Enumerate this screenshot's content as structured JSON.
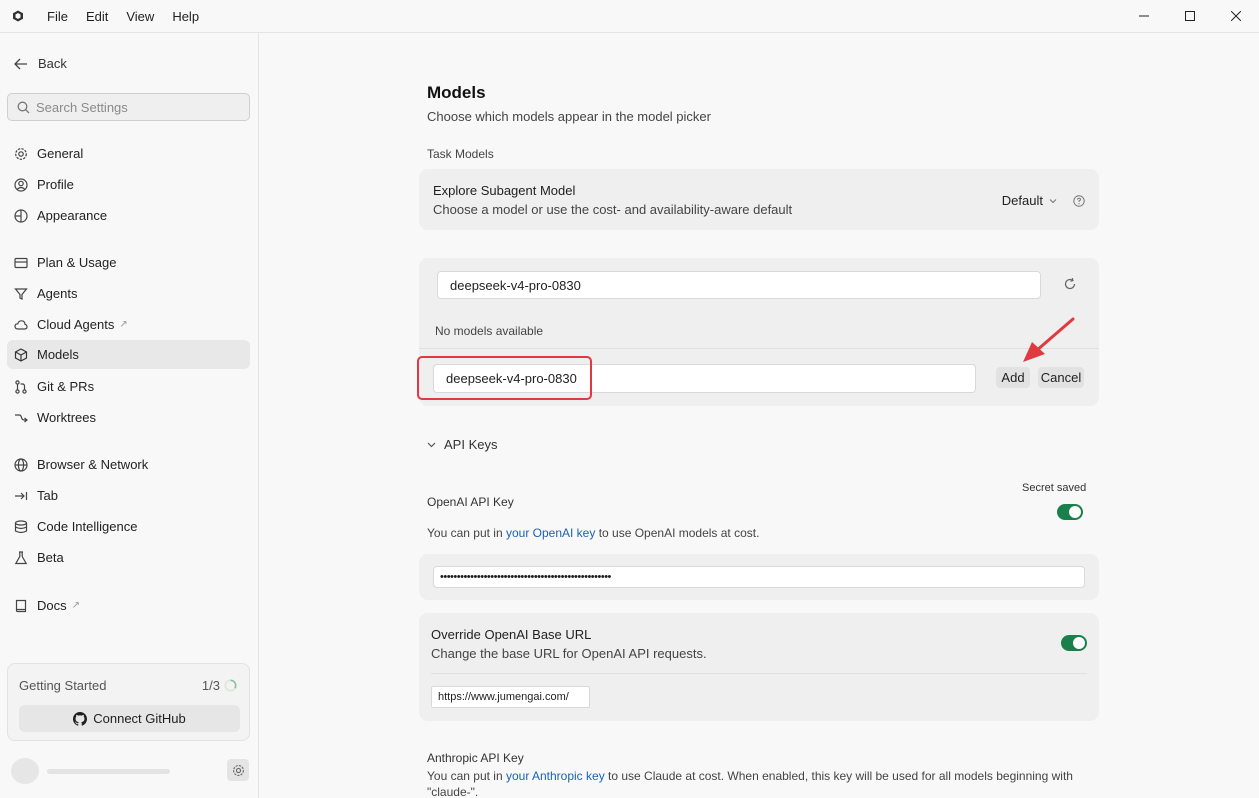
{
  "menu": {
    "file": "File",
    "edit": "Edit",
    "view": "View",
    "help": "Help"
  },
  "sidebar": {
    "back": "Back",
    "search_placeholder": "Search Settings",
    "items": [
      {
        "label": "General",
        "icon": "gear-icon"
      },
      {
        "label": "Profile",
        "icon": "user-circle-icon"
      },
      {
        "label": "Appearance",
        "icon": "appearance-icon"
      },
      {
        "label": "Plan & Usage",
        "icon": "card-icon"
      },
      {
        "label": "Agents",
        "icon": "agents-icon"
      },
      {
        "label": "Cloud Agents",
        "icon": "cloud-icon"
      },
      {
        "label": "Models",
        "icon": "cube-icon"
      },
      {
        "label": "Git & PRs",
        "icon": "git-icon"
      },
      {
        "label": "Worktrees",
        "icon": "worktree-icon"
      },
      {
        "label": "Browser & Network",
        "icon": "globe-icon"
      },
      {
        "label": "Tab",
        "icon": "tab-icon"
      },
      {
        "label": "Code Intelligence",
        "icon": "database-icon"
      },
      {
        "label": "Beta",
        "icon": "flask-icon"
      },
      {
        "label": "Docs",
        "icon": "book-icon"
      }
    ],
    "getting_started": {
      "title": "Getting Started",
      "count": "1/3",
      "connect": "Connect GitHub"
    }
  },
  "main": {
    "title": "Models",
    "subtitle": "Choose which models appear in the model picker",
    "task_models_label": "Task Models",
    "explore": {
      "title": "Explore Subagent Model",
      "desc": "Choose a model or use the cost- and availability-aware default",
      "value": "Default"
    },
    "model_search_value": "deepseek-v4-pro-0830",
    "no_models": "No models available",
    "add_input_value": "deepseek-v4-pro-0830",
    "add_label": "Add",
    "cancel_label": "Cancel",
    "api_keys_label": "API Keys",
    "openai": {
      "title": "OpenAI API Key",
      "secret_saved": "Secret saved",
      "desc_prefix": "You can put in ",
      "link": "your OpenAI key",
      "desc_suffix": " to use OpenAI models at cost.",
      "masked_value": "•••••••••••••••••••••••••••••••••••••••••••••••••••",
      "toggle_on": true
    },
    "override": {
      "title": "Override OpenAI Base URL",
      "desc": "Change the base URL for OpenAI API requests.",
      "url": "https://www.jumengai.com/",
      "toggle_on": true
    },
    "anthropic": {
      "title": "Anthropic API Key",
      "desc_prefix": "You can put in ",
      "link": "your Anthropic key",
      "desc_suffix": " to use Claude at cost. When enabled, this key will be used for all models beginning with",
      "desc_line2": "\"claude-\"."
    }
  },
  "colors": {
    "accent_toggle": "#1a7f4b",
    "highlight": "#e0393f",
    "link": "#1a62b8"
  }
}
